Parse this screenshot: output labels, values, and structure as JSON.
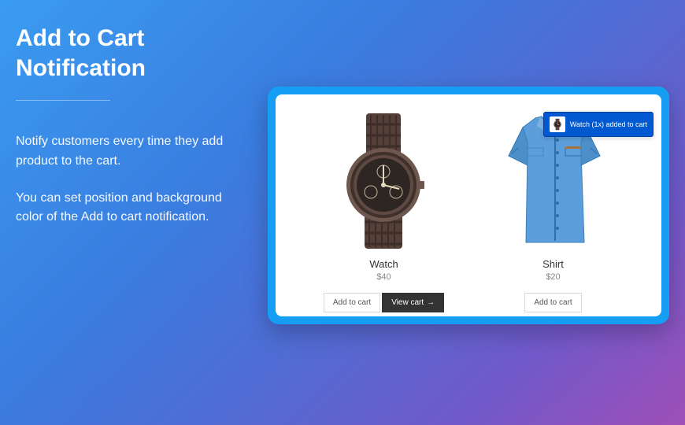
{
  "title": "Add to Cart Notification",
  "description": {
    "p1": "Notify customers every time they add product to the cart.",
    "p2": "You can set position and background color of the Add to cart notification."
  },
  "products": [
    {
      "name": "Watch",
      "price": "$40",
      "add_label": "Add to cart",
      "view_label": "View cart"
    },
    {
      "name": "Shirt",
      "price": "$20",
      "add_label": "Add to cart"
    }
  ],
  "notification": {
    "text": "Watch (1x) added to cart"
  }
}
